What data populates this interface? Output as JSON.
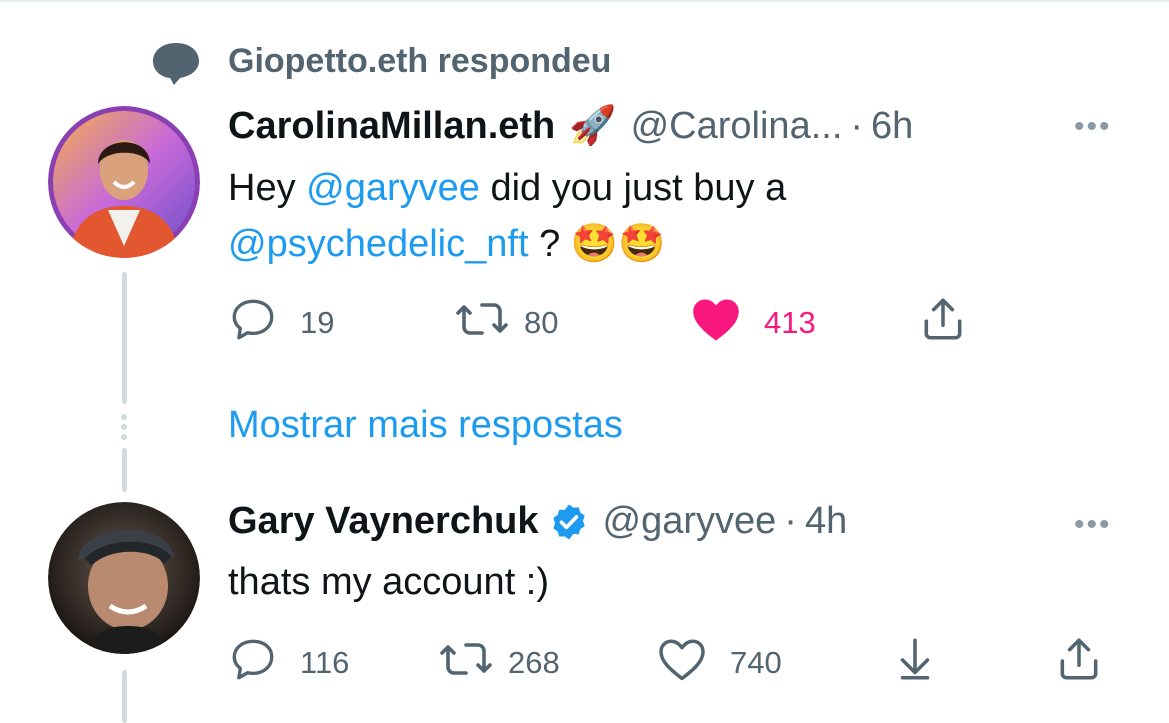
{
  "social_context": {
    "text": "Giopetto.eth respondeu",
    "icon": "speech-bubble-icon"
  },
  "tweets": [
    {
      "name": "CarolinaMillan.eth",
      "name_emoji": "🚀",
      "handle": "@Carolina...",
      "separator": "·",
      "time": "6h",
      "more": "•••",
      "text_line1_prefix": "Hey ",
      "mention1": "@garyvee",
      "text_line1_suffix": " did you just buy a",
      "mention2": "@psychedelic_nft",
      "text_line2_suffix": " ? 🤩🤩",
      "reply_count": "19",
      "retweet_count": "80",
      "like_count": "413",
      "liked": true
    },
    {
      "name": "Gary Vaynerchuk",
      "verified": true,
      "handle": "@garyvee",
      "separator": "·",
      "time": "4h",
      "more": "•••",
      "text": "thats my account :)",
      "reply_count": "116",
      "retweet_count": "268",
      "like_count": "740",
      "liked": false
    }
  ],
  "show_more": "Mostrar mais respostas",
  "colors": {
    "accent": "#1d9bf0",
    "like": "#f91880",
    "muted": "#536471",
    "thread_line": "#cfd9de"
  }
}
